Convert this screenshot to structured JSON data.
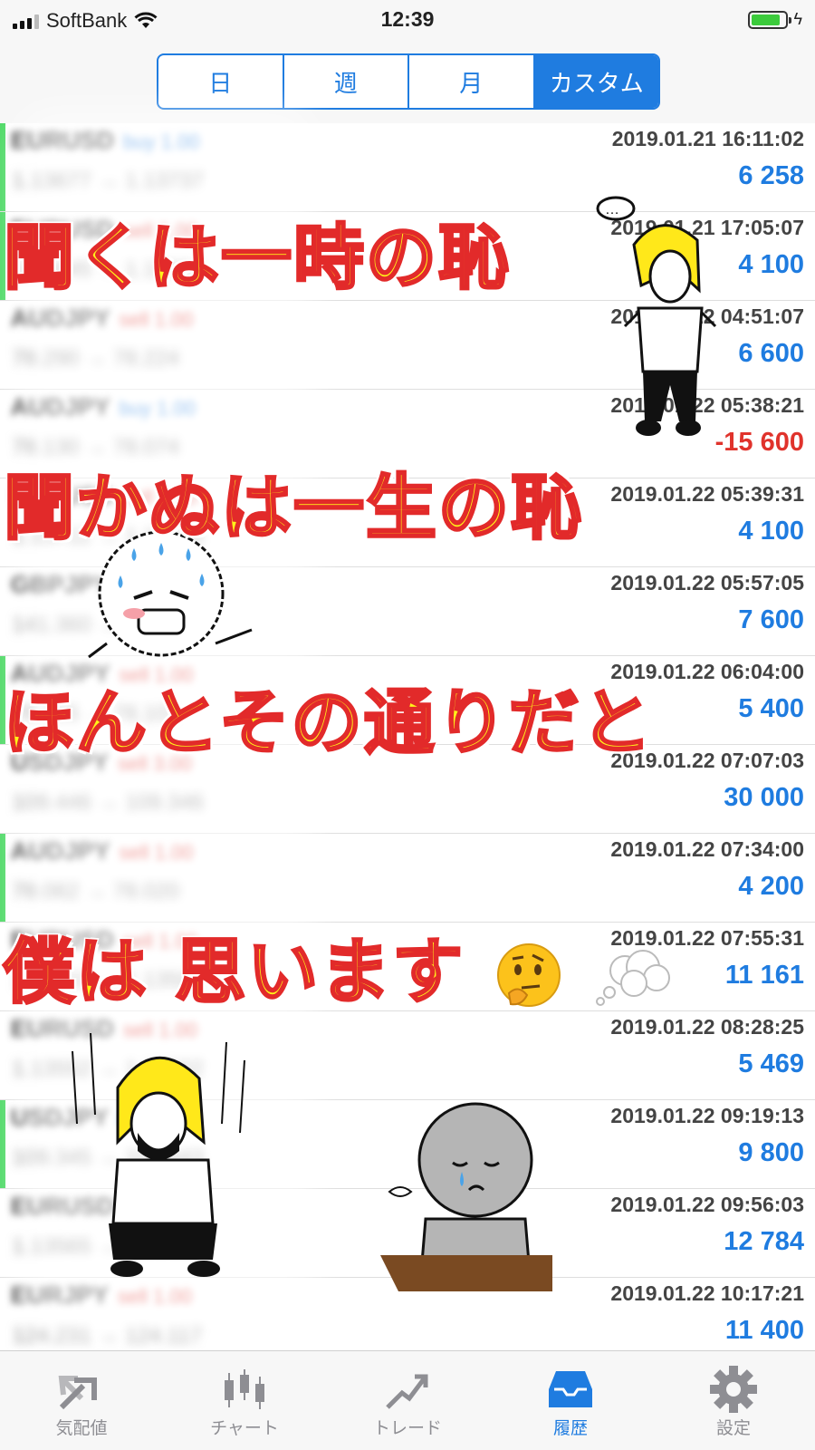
{
  "status_bar": {
    "carrier": "SoftBank",
    "time": "12:39",
    "battery_level": 0.85
  },
  "segment": {
    "tabs": [
      "日",
      "週",
      "月",
      "カスタム"
    ],
    "active_index": 3
  },
  "history": [
    {
      "symbol": "EURUSD",
      "side": "buy 1.00",
      "prices": "1.13677 → 1.13737",
      "time": "2019.01.21 16:11:02",
      "profit": "6 258",
      "indicator": "buy"
    },
    {
      "symbol": "EURUSD",
      "side": "sell 1.00",
      "prices": "1.13645 → 1.13604",
      "time": "2019.01.21 17:05:07",
      "profit": "4 100",
      "indicator": "buy"
    },
    {
      "symbol": "AUDJPY",
      "side": "sell 1.00",
      "prices": "78.290 → 78.224",
      "time": "2019.01.22 04:51:07",
      "profit": "6 600",
      "indicator": "none"
    },
    {
      "symbol": "AUDJPY",
      "side": "buy 1.00",
      "prices": "78.130 → 78.074",
      "time": "2019.01.22 05:38:21",
      "profit": "-15 600",
      "indicator": "none"
    },
    {
      "symbol": "EURUSD",
      "side": "sell 1.00",
      "prices": "1.13712 → 1.13676",
      "time": "2019.01.22 05:39:31",
      "profit": "4 100",
      "indicator": "none"
    },
    {
      "symbol": "GBPJPY",
      "side": "sell 1.00",
      "prices": "141.360 → 141.284",
      "time": "2019.01.22 05:57:05",
      "profit": "7 600",
      "indicator": "none"
    },
    {
      "symbol": "AUDJPY",
      "side": "sell 1.00",
      "prices": "78.155 → 78.101",
      "time": "2019.01.22 06:04:00",
      "profit": "5 400",
      "indicator": "buy"
    },
    {
      "symbol": "USDJPY",
      "side": "sell 3.00",
      "prices": "109.446 → 109.346",
      "time": "2019.01.22 07:07:03",
      "profit": "30 000",
      "indicator": "none"
    },
    {
      "symbol": "AUDJPY",
      "side": "sell 1.00",
      "prices": "78.062 → 78.020",
      "time": "2019.01.22 07:34:00",
      "profit": "4 200",
      "indicator": "buy"
    },
    {
      "symbol": "EURUSD",
      "side": "sell 1.00",
      "prices": "1.13610 → 1.13508",
      "time": "2019.01.22 07:55:31",
      "profit": "11 161",
      "indicator": "none"
    },
    {
      "symbol": "EURUSD",
      "side": "sell 1.00",
      "prices": "1.13552 → 1.13502",
      "time": "2019.01.22 08:28:25",
      "profit": "5 469",
      "indicator": "none"
    },
    {
      "symbol": "USDJPY",
      "side": "buy 1.00",
      "prices": "109.345 → 109.443",
      "time": "2019.01.22 09:19:13",
      "profit": "9 800",
      "indicator": "buy"
    },
    {
      "symbol": "EURUSD",
      "side": "buy 1.00",
      "prices": "1.13565 → 1.13682",
      "time": "2019.01.22 09:56:03",
      "profit": "12 784",
      "indicator": "none"
    },
    {
      "symbol": "EURJPY",
      "side": "sell 1.00",
      "prices": "124.231 → 124.117",
      "time": "2019.01.22 10:17:21",
      "profit": "11 400",
      "indicator": "none"
    }
  ],
  "captions": [
    "聞くは一時の恥",
    "聞かぬは一生の恥",
    "ほんとその通りだと",
    "僕は 思います"
  ],
  "tabbar": {
    "items": [
      {
        "label": "気配値",
        "icon": "quotes-icon"
      },
      {
        "label": "チャート",
        "icon": "chart-icon"
      },
      {
        "label": "トレード",
        "icon": "trade-icon"
      },
      {
        "label": "履歴",
        "icon": "history-icon"
      },
      {
        "label": "設定",
        "icon": "gear-icon"
      }
    ],
    "active_index": 3
  },
  "colors": {
    "accent": "#1f7ce0",
    "profit": "#1f7ce0",
    "loss": "#e0332c",
    "buy_indicator": "#4cd964",
    "caption_fill": "#fff21a",
    "caption_stroke": "#e22a2a"
  }
}
